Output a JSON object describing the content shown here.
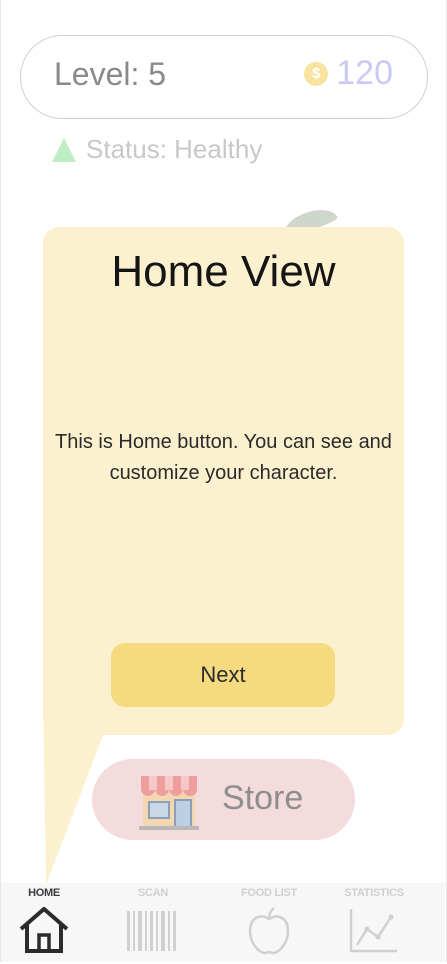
{
  "header": {
    "level_text": "Level: 5",
    "coin_symbol": "$",
    "coin_value": "120"
  },
  "status": {
    "text": "Status: Healthy"
  },
  "tooltip": {
    "title": "Home View",
    "body": "This is Home button. You can see and customize your character.",
    "next_label": "Next"
  },
  "store": {
    "label": "Store"
  },
  "nav": {
    "home": "HOME",
    "scan": "SCAN",
    "food_list": "FOOD LIST",
    "statistics": "STATISTICS"
  },
  "colors": {
    "bubble": "#fcf1cf",
    "next_button": "#f5da7f",
    "store_button": "#f4dcdc",
    "coin_value": "#c9c9f3",
    "status_icon": "#bfeec4"
  }
}
